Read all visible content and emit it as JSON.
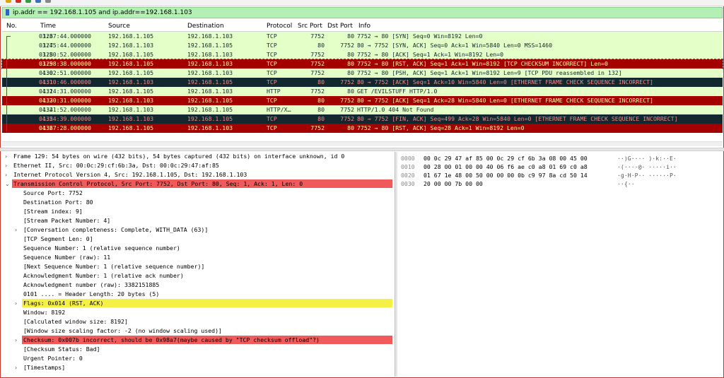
{
  "filter": {
    "value": "ip.addr == 192.168.1.105 and ip.addr==192.168.1.103"
  },
  "columns": [
    "No.",
    "Time",
    "Source",
    "Destination",
    "Protocol",
    "Src Port",
    "Dst Port",
    "Info"
  ],
  "colors": {
    "green": "#e4ffc7",
    "red": "#a40000",
    "dark": "#12272e",
    "header_selected_red": "#ef5a5a",
    "flags_yellow": "#f4f046",
    "filter_bg": "#b4f0b4"
  },
  "packets": [
    {
      "no": "126",
      "time": "03:37:44.000000",
      "src": "192.168.1.105",
      "dst": "192.168.1.103",
      "proto": "TCP",
      "sport": "7752",
      "dport": "80",
      "info": "7752 → 80 [SYN] Seq=0 Win=8192 Len=0",
      "style": "green"
    },
    {
      "no": "127",
      "time": "03:45:44.000000",
      "src": "192.168.1.103",
      "dst": "192.168.1.105",
      "proto": "TCP",
      "sport": "80",
      "dport": "7752",
      "info": "80 → 7752 [SYN, ACK] Seq=0 Ack=1 Win=5840 Len=0 MSS=1460",
      "style": "green"
    },
    {
      "no": "128",
      "time": "03:50:52.000000",
      "src": "192.168.1.105",
      "dst": "192.168.1.103",
      "proto": "TCP",
      "sport": "7752",
      "dport": "80",
      "info": "7752 → 80 [ACK] Seq=1 Ack=1 Win=8192 Len=0",
      "style": "green"
    },
    {
      "no": "129",
      "time": "03:58:38.000000",
      "src": "192.168.1.105",
      "dst": "192.168.1.103",
      "proto": "TCP",
      "sport": "7752",
      "dport": "80",
      "info": "7752 → 80 [RST, ACK] Seq=1 Ack=1 Win=8192 [TCP CHECKSUM INCORRECT] Len=0",
      "style": "red"
    },
    {
      "no": "130",
      "time": "04:02:51.000000",
      "src": "192.168.1.105",
      "dst": "192.168.1.103",
      "proto": "TCP",
      "sport": "7752",
      "dport": "80",
      "info": "7752 → 80 [PSH, ACK] Seq=1 Ack=1 Win=8192 Len=9 [TCP PDU reassembled in 132]",
      "style": "green"
    },
    {
      "no": "131",
      "time": "04:10:46.000000",
      "src": "192.168.1.103",
      "dst": "192.168.1.105",
      "proto": "TCP",
      "sport": "80",
      "dport": "7752",
      "info": "80 → 7752 [ACK] Seq=1 Ack=10 Win=5840 Len=0 [ETHERNET FRAME CHECK SEQUENCE INCORRECT]",
      "style": "dark"
    },
    {
      "no": "132",
      "time": "04:14:31.000000",
      "src": "192.168.1.105",
      "dst": "192.168.1.103",
      "proto": "HTTP",
      "sport": "7752",
      "dport": "80",
      "info": "GET /EVILSTUFF HTTP/1.0",
      "style": "green"
    },
    {
      "no": "133",
      "time": "04:20:31.000000",
      "src": "192.168.1.103",
      "dst": "192.168.1.105",
      "proto": "TCP",
      "sport": "80",
      "dport": "7752",
      "info": "80 → 7752 [ACK] Seq=1 Ack=28 Win=5840 Len=0 [ETHERNET FRAME CHECK SEQUENCE INCORRECT]",
      "style": "red"
    },
    {
      "no": "134",
      "time": "04:21:52.000000",
      "src": "192.168.1.103",
      "dst": "192.168.1.105",
      "proto": "HTTP/X…",
      "sport": "80",
      "dport": "7752",
      "info": "HTTP/1.0 404 Not Found",
      "style": "green"
    },
    {
      "no": "135",
      "time": "04:24:39.000000",
      "src": "192.168.1.103",
      "dst": "192.168.1.105",
      "proto": "TCP",
      "sport": "80",
      "dport": "7752",
      "info": "80 → 7752 [FIN, ACK] Seq=499 Ack=28 Win=5840 Len=0 [ETHERNET FRAME CHECK SEQUENCE INCORRECT]",
      "style": "dark"
    },
    {
      "no": "136",
      "time": "04:27:28.000000",
      "src": "192.168.1.105",
      "dst": "192.168.1.103",
      "proto": "TCP",
      "sport": "7752",
      "dport": "80",
      "info": "7752 → 80 [RST, ACK] Seq=28 Ack=1 Win=8192 Len=0",
      "style": "red"
    }
  ],
  "details": [
    {
      "text": "Frame 129: 54 bytes on wire (432 bits), 54 bytes captured (432 bits) on interface unknown, id 0",
      "arrow": "›",
      "level": 0,
      "style": "normal"
    },
    {
      "text": "Ethernet II, Src: 00:0c:29:cf:6b:3a, Dst: 00:0c:29:47:af:85",
      "arrow": "›",
      "level": 0,
      "style": "normal"
    },
    {
      "text": "Internet Protocol Version 4, Src: 192.168.1.105, Dst: 192.168.1.103",
      "arrow": "›",
      "level": 0,
      "style": "normal"
    },
    {
      "text": "Transmission Control Protocol, Src Port: 7752, Dst Port: 80, Seq: 1, Ack: 1, Len: 0",
      "arrow": "⌄",
      "level": 0,
      "style": "red"
    },
    {
      "text": "Source Port: 7752",
      "arrow": "",
      "level": 1,
      "style": "normal"
    },
    {
      "text": "Destination Port: 80",
      "arrow": "",
      "level": 1,
      "style": "normal"
    },
    {
      "text": "[Stream index: 9]",
      "arrow": "",
      "level": 1,
      "style": "normal"
    },
    {
      "text": "[Stream Packet Number: 4]",
      "arrow": "",
      "level": 1,
      "style": "normal"
    },
    {
      "text": "[Conversation completeness: Complete, WITH_DATA (63)]",
      "arrow": "›",
      "level": 1,
      "style": "normal"
    },
    {
      "text": "[TCP Segment Len: 0]",
      "arrow": "",
      "level": 1,
      "style": "normal"
    },
    {
      "text": "Sequence Number: 1    (relative sequence number)",
      "arrow": "",
      "level": 1,
      "style": "normal"
    },
    {
      "text": "Sequence Number (raw): 11",
      "arrow": "",
      "level": 1,
      "style": "normal"
    },
    {
      "text": "[Next Sequence Number: 1    (relative sequence number)]",
      "arrow": "",
      "level": 1,
      "style": "normal"
    },
    {
      "text": "Acknowledgment Number: 1    (relative ack number)",
      "arrow": "",
      "level": 1,
      "style": "normal"
    },
    {
      "text": "Acknowledgment number (raw): 3382151885",
      "arrow": "",
      "level": 1,
      "style": "normal"
    },
    {
      "text": "0101 .... = Header Length: 20 bytes (5)",
      "arrow": "",
      "level": 1,
      "style": "normal"
    },
    {
      "text": "Flags: 0x014 (RST, ACK)",
      "arrow": "›",
      "level": 1,
      "style": "yellow"
    },
    {
      "text": "Window: 8192",
      "arrow": "",
      "level": 1,
      "style": "normal"
    },
    {
      "text": "[Calculated window size: 8192]",
      "arrow": "",
      "level": 1,
      "style": "normal"
    },
    {
      "text": "[Window size scaling factor: -2 (no window scaling used)]",
      "arrow": "",
      "level": 1,
      "style": "normal"
    },
    {
      "text": "Checksum: 0x007b incorrect, should be 0x98a7(maybe caused by \"TCP checksum offload\"?)",
      "arrow": "›",
      "level": 1,
      "style": "red"
    },
    {
      "text": "[Checksum Status: Bad]",
      "arrow": "",
      "level": 1,
      "style": "normal"
    },
    {
      "text": "Urgent Pointer: 0",
      "arrow": "",
      "level": 1,
      "style": "normal"
    },
    {
      "text": "[Timestamps]",
      "arrow": "›",
      "level": 1,
      "style": "normal"
    }
  ],
  "bytes": [
    {
      "offset": "0000",
      "hex": "00 0c 29 47 af 85 00 0c  29 cf 6b 3a 08 00 45 00",
      "ascii": "··)G···· )·k:··E·"
    },
    {
      "offset": "0010",
      "hex": "00 28 00 01 00 00 40 06  f6 ae c0 a8 01 69 c0 a8",
      "ascii": "·(····@· ·····i··"
    },
    {
      "offset": "0020",
      "hex": "01 67 1e 48 00 50 00 00  00 0b c9 97 8a cd 50 14",
      "ascii": "·g·H·P·· ······P·"
    },
    {
      "offset": "0030",
      "hex": "20 00 00 7b 00 00",
      "ascii": " ··{··"
    }
  ]
}
